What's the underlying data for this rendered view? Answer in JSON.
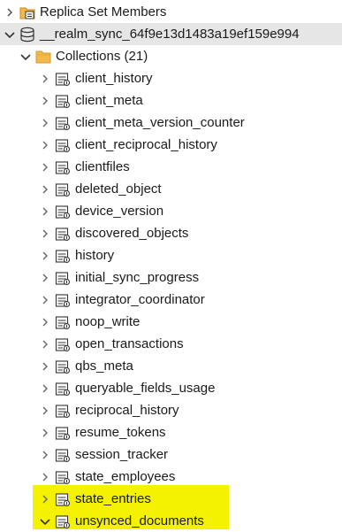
{
  "tree": {
    "replica_set": {
      "label": "Replica Set Members"
    },
    "database": {
      "label": "__realm_sync_64f9e13d1483a19ef159e994"
    },
    "collections_folder": {
      "label": "Collections (21)"
    },
    "collections": [
      {
        "label": "client_history",
        "expanded": false
      },
      {
        "label": "client_meta",
        "expanded": false
      },
      {
        "label": "client_meta_version_counter",
        "expanded": false
      },
      {
        "label": "client_reciprocal_history",
        "expanded": false
      },
      {
        "label": "clientfiles",
        "expanded": false
      },
      {
        "label": "deleted_object",
        "expanded": false
      },
      {
        "label": "device_version",
        "expanded": false
      },
      {
        "label": "discovered_objects",
        "expanded": false
      },
      {
        "label": "history",
        "expanded": false
      },
      {
        "label": "initial_sync_progress",
        "expanded": false
      },
      {
        "label": "integrator_coordinator",
        "expanded": false
      },
      {
        "label": "noop_write",
        "expanded": false
      },
      {
        "label": "open_transactions",
        "expanded": false
      },
      {
        "label": "qbs_meta",
        "expanded": false
      },
      {
        "label": "queryable_fields_usage",
        "expanded": false
      },
      {
        "label": "reciprocal_history",
        "expanded": false
      },
      {
        "label": "resume_tokens",
        "expanded": false
      },
      {
        "label": "session_tracker",
        "expanded": false
      },
      {
        "label": "state_employees",
        "expanded": false
      },
      {
        "label": "state_entries",
        "expanded": false
      },
      {
        "label": "unsynced_documents",
        "expanded": true
      }
    ]
  },
  "colors": {
    "highlight": "#f4f200",
    "selected_row": "#e6e6e6",
    "folder": "#f2b84b",
    "chevron": "#555555",
    "icon_stroke": "#333333"
  }
}
